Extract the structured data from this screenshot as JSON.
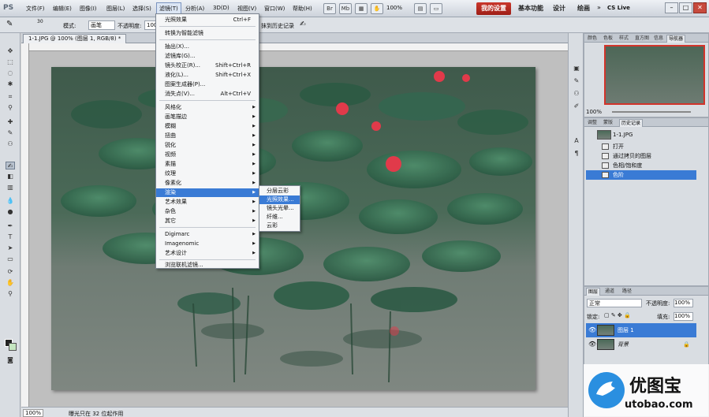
{
  "app": {
    "logo": "PS"
  },
  "menubar": {
    "items": [
      "文件(F)",
      "编辑(E)",
      "图像(I)",
      "图层(L)",
      "选择(S)",
      "滤镜(T)",
      "分析(A)",
      "3D(D)",
      "视图(V)",
      "窗口(W)",
      "帮助(H)"
    ],
    "zoom": "100%",
    "workspaces": [
      "我的设置",
      "基本功能",
      "设计",
      "绘画"
    ],
    "cs_live": "CS Live"
  },
  "options": {
    "mode_label": "模式:",
    "mode_value": "画笔",
    "opacity_label": "不透明度:",
    "opacity_value": "100",
    "erase_history": "抹到历史记录",
    "brush_size": "30"
  },
  "document": {
    "tab_title": "1-1.JPG @ 100% (图层 1, RGB/8) *",
    "zoom": "100%",
    "status": "曝光只在 32 位起作用"
  },
  "filter_menu": {
    "items": [
      {
        "label": "光照效果",
        "shortcut": "Ctrl+F"
      },
      {
        "label": "转换为智能滤镜"
      },
      {
        "label": "抽出(X)..."
      },
      {
        "label": "滤镜库(G)..."
      },
      {
        "label": "镜头校正(R)...",
        "shortcut": "Shift+Ctrl+R"
      },
      {
        "label": "液化(L)...",
        "shortcut": "Shift+Ctrl+X"
      },
      {
        "label": "图案生成器(P)..."
      },
      {
        "label": "消失点(V)...",
        "shortcut": "Alt+Ctrl+V"
      },
      {
        "label": "风格化"
      },
      {
        "label": "画笔描边"
      },
      {
        "label": "模糊"
      },
      {
        "label": "扭曲"
      },
      {
        "label": "锐化"
      },
      {
        "label": "视频"
      },
      {
        "label": "素描"
      },
      {
        "label": "纹理"
      },
      {
        "label": "像素化"
      },
      {
        "label": "渲染"
      },
      {
        "label": "艺术效果"
      },
      {
        "label": "杂色"
      },
      {
        "label": "其它"
      },
      {
        "label": "Digimarc"
      },
      {
        "label": "Imagenomic"
      },
      {
        "label": "艺术设计"
      },
      {
        "label": "浏览联机滤镜..."
      }
    ],
    "submenu": [
      "分层云彩",
      "光照效果...",
      "镜头光晕...",
      "纤维...",
      "云彩"
    ]
  },
  "navigator": {
    "tabs": [
      "颜色",
      "色板",
      "样式",
      "直方图",
      "信息",
      "导航器"
    ],
    "zoom": "100%"
  },
  "history": {
    "tabs": [
      "调整",
      "蒙版",
      "历史记录"
    ],
    "snapshot": "1-1.JPG",
    "steps": [
      "打开",
      "通过拷贝的图层",
      "色相/饱和度",
      "色阶"
    ]
  },
  "layers": {
    "tabs": [
      "图层",
      "通道",
      "路径"
    ],
    "blend_mode": "正常",
    "opacity_label": "不透明度:",
    "opacity_value": "100%",
    "lock_label": "锁定:",
    "fill_label": "填充:",
    "fill_value": "100%",
    "rows": [
      "图层 1",
      "背景"
    ]
  },
  "watermark": {
    "brand": "优图宝",
    "url": "utobao.com"
  },
  "colors": {
    "highlight": "#3a7bd5",
    "workspace_active": "#b5281f",
    "lotus": "#e13a4a"
  }
}
